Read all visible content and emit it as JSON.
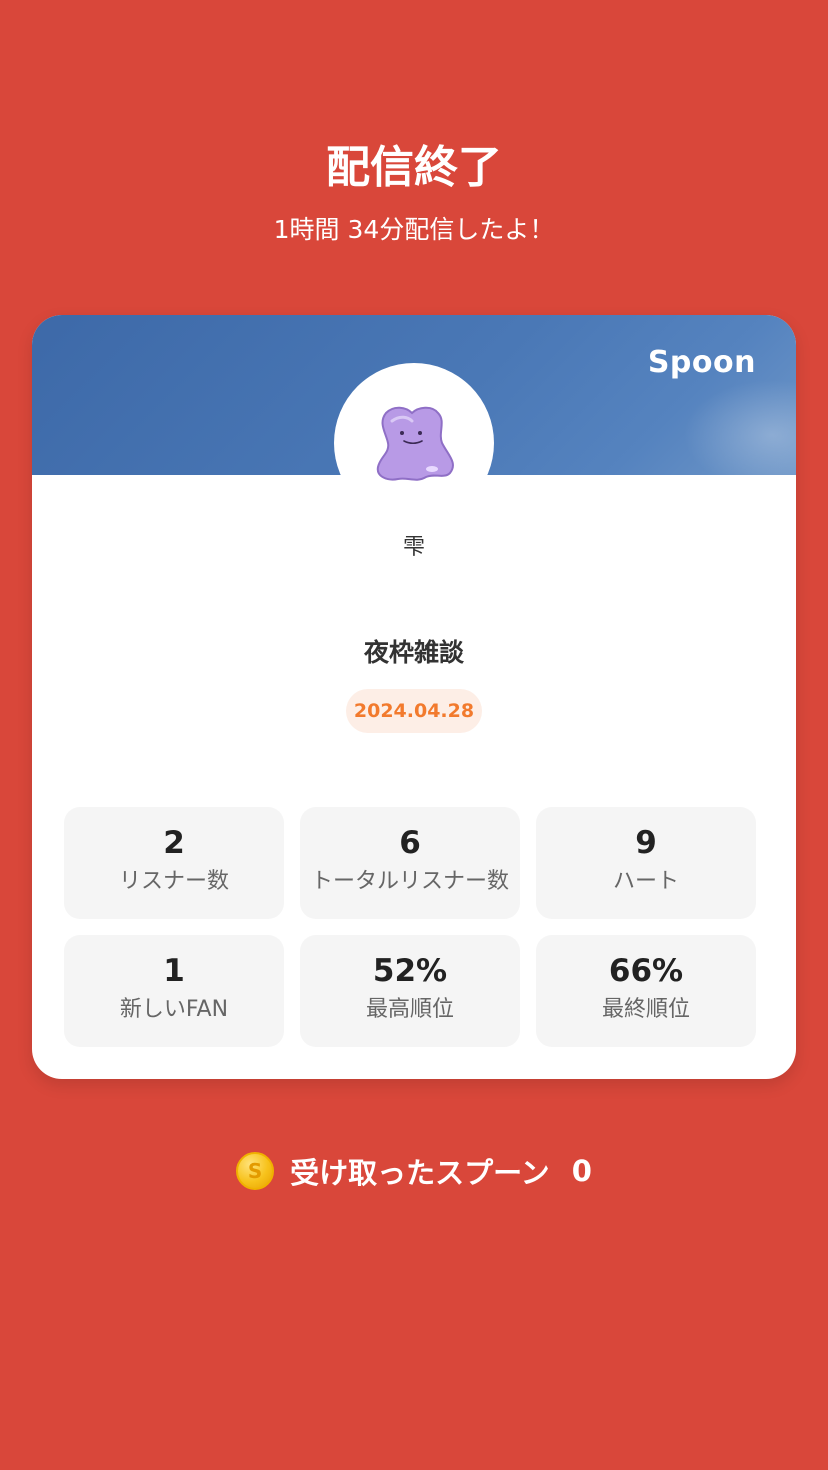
{
  "header": {
    "title": "配信終了",
    "subtitle": "1時間 34分配信したよ！"
  },
  "card": {
    "brand": "Spoon",
    "avatar_icon": "ditto-avatar-icon",
    "username": "雫",
    "show_title": "夜枠雑談",
    "date": "2024.04.28",
    "stats": [
      {
        "value": "2",
        "label": "リスナー数"
      },
      {
        "value": "6",
        "label": "トータルリスナー数"
      },
      {
        "value": "9",
        "label": "ハート"
      },
      {
        "value": "1",
        "label": "新しいFAN"
      },
      {
        "value": "52%",
        "label": "最高順位"
      },
      {
        "value": "66%",
        "label": "最終順位"
      }
    ]
  },
  "spoons": {
    "icon": "coin-icon",
    "coin_letter": "S",
    "label": "受け取ったスプーン",
    "count": "0"
  },
  "colors": {
    "background": "#d9473a",
    "banner": "#4a78b6",
    "date_accent": "#f27a2d"
  }
}
